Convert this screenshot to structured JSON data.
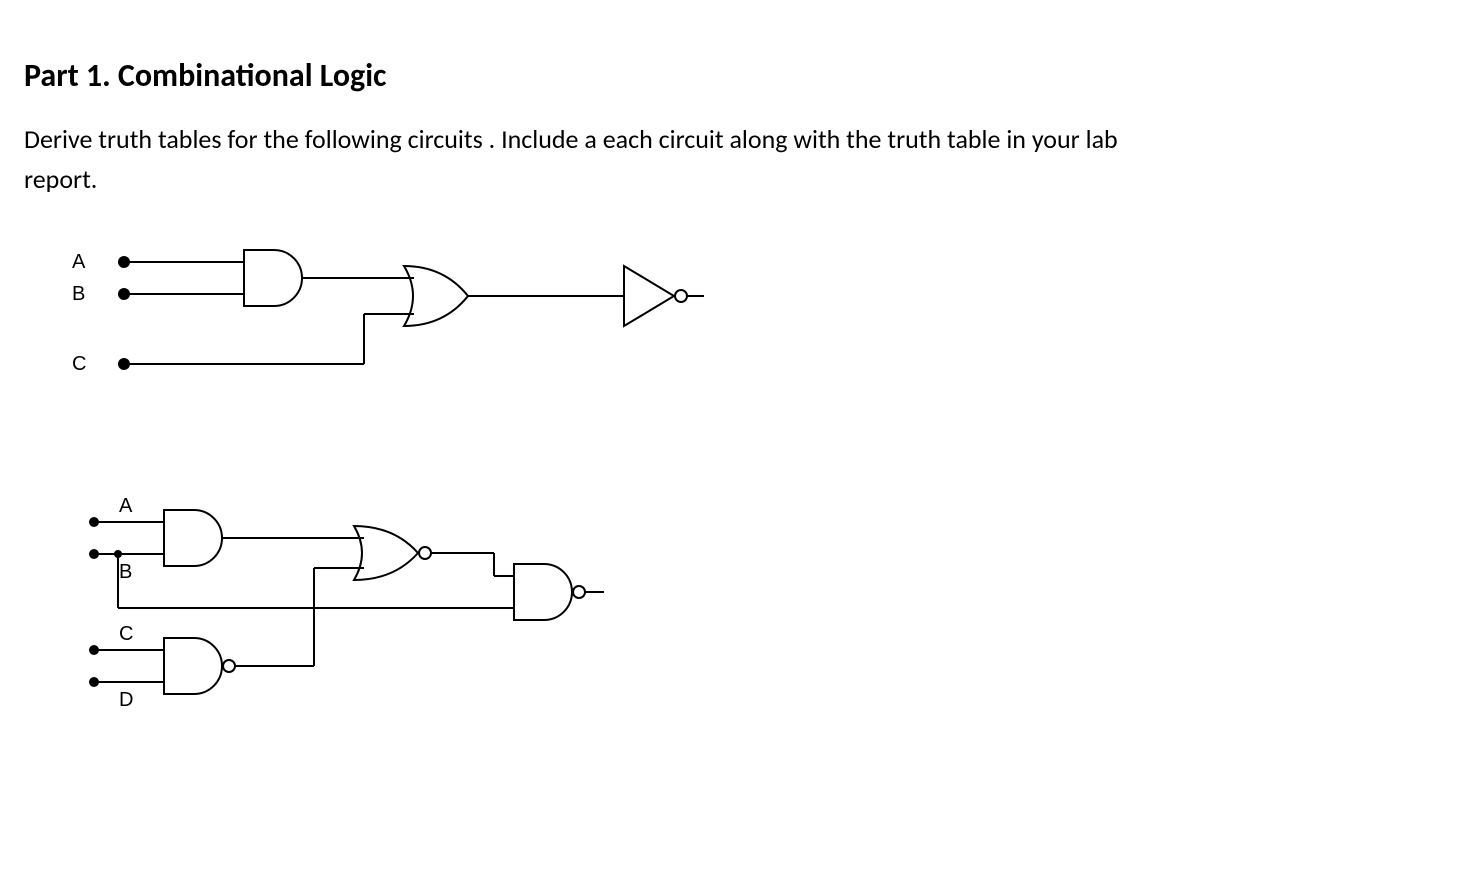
{
  "heading": "Part 1. Combinational Logic",
  "instructions": "Derive truth tables for the following circuits . Include a  each circuit along with the truth table in your lab report.",
  "circuit1": {
    "inputs": {
      "A": "A",
      "B": "B",
      "C": "C"
    },
    "gates": [
      "AND2",
      "OR2",
      "NOT"
    ],
    "expression_note": "NOT( (A AND B) OR C )"
  },
  "circuit2": {
    "inputs": {
      "A": "A",
      "B": "B",
      "C": "C",
      "D": "D"
    },
    "gates": [
      "AND2",
      "NAND2",
      "NOR2",
      "NAND2"
    ],
    "expression_note": "NAND( NOR( A·B , NAND(C,D) ) , B )"
  }
}
